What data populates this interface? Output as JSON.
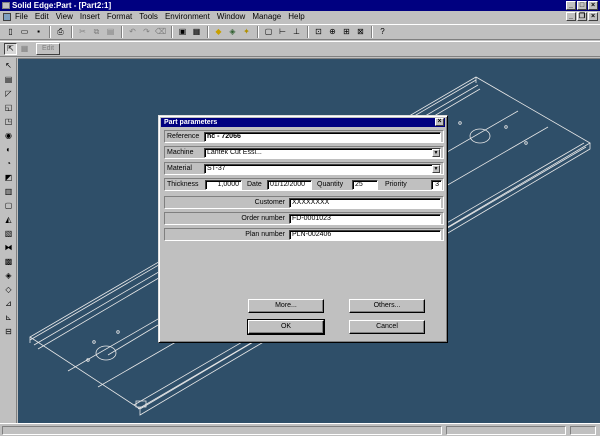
{
  "window": {
    "title": "Solid Edge:Part - [Part2:1]"
  },
  "menu": [
    "File",
    "Edit",
    "View",
    "Insert",
    "Format",
    "Tools",
    "Environment",
    "Window",
    "Manage",
    "Help"
  ],
  "toolbar2": {
    "edit_label": "Edit"
  },
  "dialog": {
    "title": "Part parameters",
    "reference": {
      "label": "Reference",
      "value": "hc - 72066"
    },
    "machine": {
      "label": "Machine",
      "value": "Lantek Cut Essi..."
    },
    "material": {
      "label": "Material",
      "value": "ST-37"
    },
    "thickness": {
      "label": "Thickness",
      "value": "1,0000"
    },
    "date": {
      "label": "Date",
      "value": "01/12/2000"
    },
    "quantity": {
      "label": "Quantity",
      "value": "25"
    },
    "priority": {
      "label": "Priority",
      "value": "3"
    },
    "customer": {
      "label": "Customer",
      "value": "XXXXXXXX"
    },
    "order_number": {
      "label": "Order number",
      "value": "FD-0001023"
    },
    "plan_number": {
      "label": "Plan number",
      "value": "PLN-002406"
    },
    "buttons": {
      "more": "More...",
      "others": "Others...",
      "ok": "OK",
      "cancel": "Cancel"
    }
  }
}
